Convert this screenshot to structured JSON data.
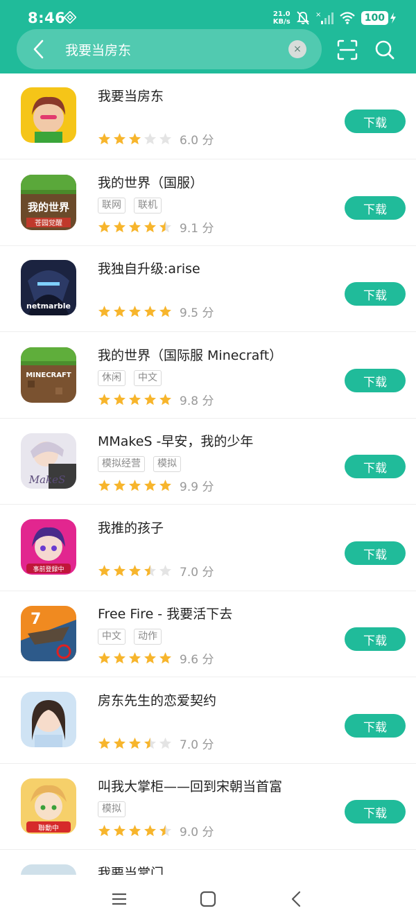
{
  "status_bar": {
    "time": "8:46",
    "net_speed_value": "21.0",
    "net_speed_unit": "KB/s",
    "battery": "100"
  },
  "search": {
    "query": "我要当房东",
    "clear_glyph": "×"
  },
  "colors": {
    "brand": "#20bb9a",
    "star_filled": "#f7b52c",
    "star_empty": "#e4e4e4"
  },
  "results": [
    {
      "title": "我要当房东",
      "tags": [],
      "stars": 3,
      "score": "6.0 分",
      "download_label": "下载",
      "icon": "landlord-game-icon"
    },
    {
      "title": "我的世界（国服）",
      "tags": [
        "联网",
        "联机"
      ],
      "stars": 4.5,
      "score": "9.1 分",
      "download_label": "下载",
      "icon": "minecraft-cn-icon"
    },
    {
      "title": "我独自升级:arise",
      "tags": [],
      "stars": 5,
      "score": "9.5 分",
      "download_label": "下载",
      "icon": "solo-leveling-icon"
    },
    {
      "title": "我的世界（国际服 Minecraft）",
      "tags": [
        "休闲",
        "中文"
      ],
      "stars": 5,
      "score": "9.8 分",
      "download_label": "下载",
      "icon": "minecraft-icon"
    },
    {
      "title": "MMakeS -早安，我的少年",
      "tags": [
        "模拟经营",
        "模拟"
      ],
      "stars": 5,
      "score": "9.9 分",
      "download_label": "下载",
      "icon": "mmakes-icon"
    },
    {
      "title": "我推的孩子",
      "tags": [],
      "stars": 3.5,
      "score": "7.0 分",
      "download_label": "下载",
      "icon": "oshi-no-ko-icon"
    },
    {
      "title": "Free Fire - 我要活下去",
      "tags": [
        "中文",
        "动作"
      ],
      "stars": 5,
      "score": "9.6 分",
      "download_label": "下载",
      "icon": "free-fire-icon"
    },
    {
      "title": "房东先生的恋爱契约",
      "tags": [],
      "stars": 3.5,
      "score": "7.0 分",
      "download_label": "下载",
      "icon": "romance-contract-icon"
    },
    {
      "title": "叫我大掌柜——回到宋朝当首富",
      "tags": [
        "模拟"
      ],
      "stars": 4.5,
      "score": "9.0 分",
      "download_label": "下载",
      "icon": "shopkeeper-icon"
    },
    {
      "title": "我要当掌门",
      "tags": [],
      "stars": 0,
      "score": "",
      "download_label": "",
      "icon": "sect-master-icon"
    }
  ]
}
